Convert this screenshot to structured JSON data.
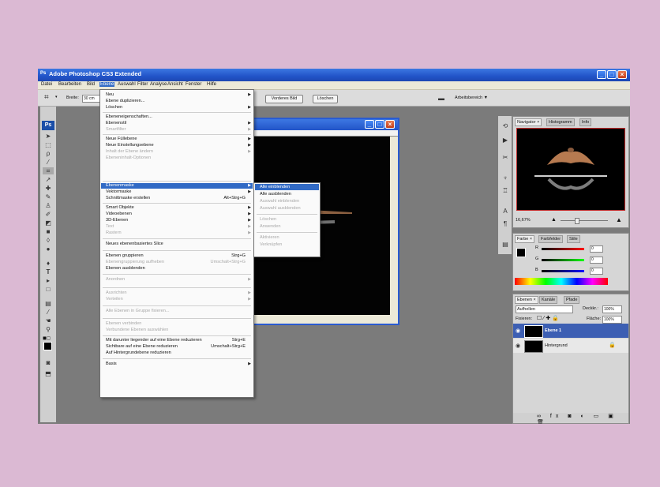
{
  "app": {
    "title": "Adobe Photoshop CS3 Extended"
  },
  "menubar": [
    "Datei",
    "Bearbeiten",
    "Bild",
    "Ebene",
    "Auswahl",
    "Filter",
    "Analyse",
    "Ansicht",
    "Fenster",
    "Hilfe"
  ],
  "options": {
    "width_label": "Breite:",
    "width_value": "30 cm",
    "front_image": "Vorderes Bild",
    "clear": "Löschen",
    "workspace": "Arbeitsbereich ▼"
  },
  "layer_menu": {
    "items": [
      {
        "label": "Neu",
        "submenu": true
      },
      {
        "label": "Ebene duplizieren..."
      },
      {
        "label": "Löschen",
        "submenu": true
      },
      {
        "label": "Ebeneneigenschaften..."
      },
      {
        "label": "Ebenenstil",
        "submenu": true
      },
      {
        "label": "Smartfilter",
        "disabled": true,
        "submenu": true
      },
      {
        "label": "Neue Füllebene",
        "submenu": true
      },
      {
        "label": "Neue Einstellungsebene",
        "submenu": true
      },
      {
        "label": "Inhalt der Ebene ändern",
        "disabled": true,
        "submenu": true
      },
      {
        "label": "Ebeneninhalt-Optionen",
        "disabled": true
      },
      {
        "label": "Ebenenmaske",
        "submenu": true,
        "highlight": true
      },
      {
        "label": "Vektormaske",
        "submenu": true
      },
      {
        "label": "Schnittmaske erstellen",
        "shortcut": "Alt+Strg+G"
      },
      {
        "label": "Smart Objekte",
        "submenu": true
      },
      {
        "label": "Videoebenen",
        "submenu": true
      },
      {
        "label": "3D-Ebenen",
        "submenu": true
      },
      {
        "label": "Text",
        "disabled": true,
        "submenu": true
      },
      {
        "label": "Rastern",
        "disabled": true,
        "submenu": true
      },
      {
        "label": "Neues ebenenbasiertes Slice"
      },
      {
        "label": "Ebenen gruppieren",
        "shortcut": "Strg+G"
      },
      {
        "label": "Ebenengruppierung aufheben",
        "disabled": true,
        "shortcut": "Umschalt+Strg+G"
      },
      {
        "label": "Ebenen ausblenden"
      },
      {
        "label": "Anordnen",
        "disabled": true,
        "submenu": true
      },
      {
        "label": "Ausrichten",
        "disabled": true,
        "submenu": true
      },
      {
        "label": "Verteilen",
        "disabled": true,
        "submenu": true
      },
      {
        "label": "Alle Ebenen in Gruppe fixieren...",
        "disabled": true
      },
      {
        "label": "Ebenen verbinden",
        "disabled": true
      },
      {
        "label": "Verbundene Ebenen auswählen",
        "disabled": true
      },
      {
        "label": "Mit darunter liegender auf eine Ebene reduzieren",
        "shortcut": "Strg+E"
      },
      {
        "label": "Sichtbare auf eine Ebene reduzieren",
        "shortcut": "Umschalt+Strg+E"
      },
      {
        "label": "Auf Hintergrundebene reduzieren"
      },
      {
        "label": "Basis",
        "submenu": true
      }
    ]
  },
  "mask_submenu": [
    {
      "label": "Alle einblenden",
      "highlight": true
    },
    {
      "label": "Alle ausblenden"
    },
    {
      "label": "Auswahl einblenden",
      "disabled": true
    },
    {
      "label": "Auswahl ausblenden",
      "disabled": true
    },
    {
      "label": "Löschen",
      "disabled": true
    },
    {
      "label": "Anwenden",
      "disabled": true
    },
    {
      "label": "Aktivieren",
      "disabled": true
    },
    {
      "label": "Verknüpfen",
      "disabled": true
    }
  ],
  "navigator": {
    "tabs": [
      "Navigator ×",
      "Histogramm",
      "Info"
    ],
    "zoom": "16,67%"
  },
  "color": {
    "tabs": [
      "Farbe ×",
      "Farbfelder",
      "Stile"
    ],
    "r": "0",
    "g": "0",
    "b": "0",
    "r_label": "R",
    "g_label": "G",
    "b_label": "B"
  },
  "layers": {
    "tabs": [
      "Ebenen ×",
      "Kanäle",
      "Pfade"
    ],
    "blend": "Aufhellen",
    "opacity_label": "Deckkr.:",
    "opacity": "100%",
    "lock_label": "Fixieren:",
    "fill_label": "Fläche:",
    "fill": "100%",
    "rows": [
      {
        "name": "Ebene 1",
        "selected": true
      },
      {
        "name": "Hintergrund",
        "selected": false
      }
    ]
  },
  "colors": {
    "accent": "#316ac5",
    "titlebar": "#2254c8",
    "background": "#dbb9d3"
  }
}
